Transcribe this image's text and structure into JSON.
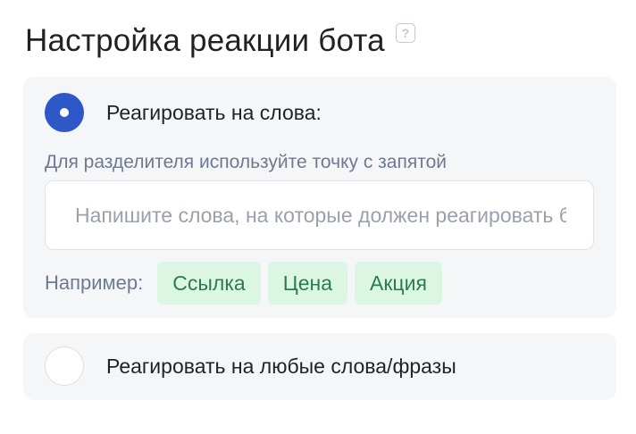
{
  "header": {
    "title": "Настройка реакции бота",
    "help_glyph": "?"
  },
  "option_words": {
    "label": "Реагировать на слова:",
    "selected": true,
    "hint": "Для разделителя используйте точку с запятой",
    "input": {
      "value": "",
      "placeholder": "Напишите слова, на которые должен реагировать бот"
    },
    "examples_label": "Например:",
    "examples": [
      "Ссылка",
      "Цена",
      "Акция"
    ]
  },
  "option_any": {
    "label": "Реагировать на любые слова/фразы",
    "selected": false
  },
  "colors": {
    "accent": "#2e58c7",
    "chip_bg": "#dcf6e4",
    "chip_text": "#2d7a52",
    "card_bg": "#f5f6f8",
    "muted_text": "#6e7a92"
  }
}
